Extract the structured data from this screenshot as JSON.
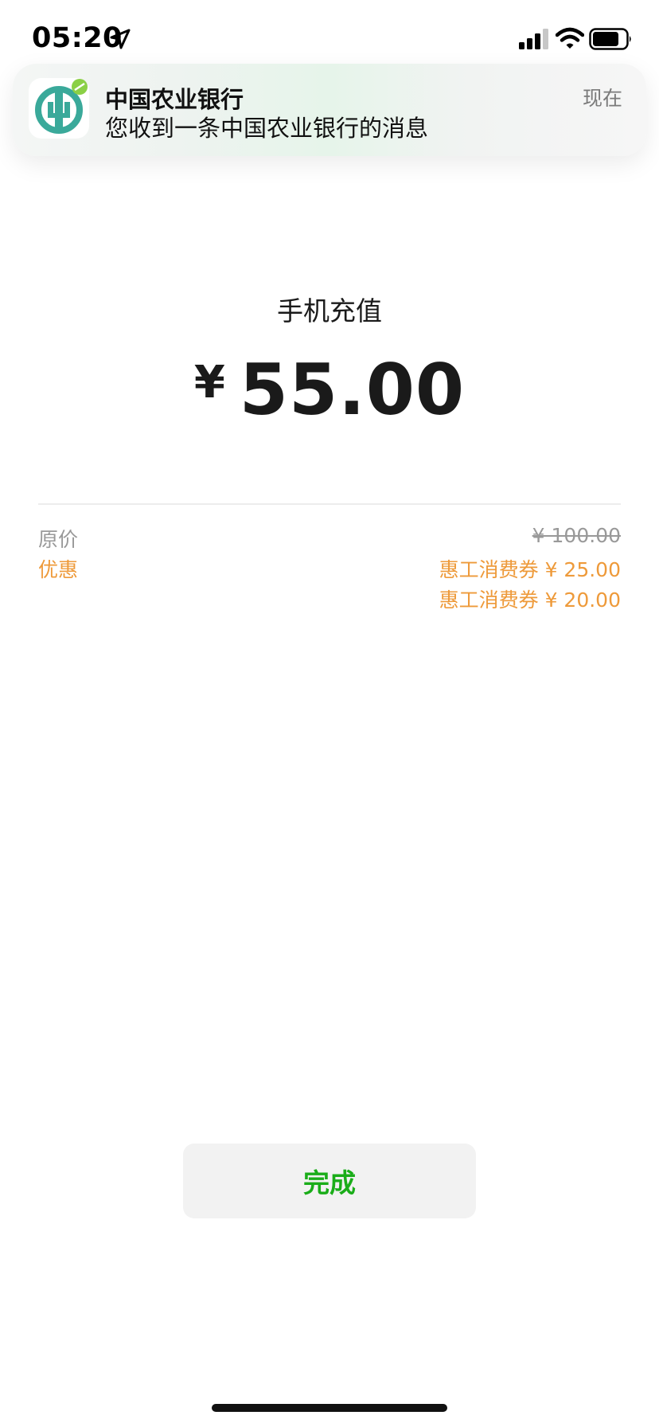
{
  "status_bar": {
    "time": "05:20",
    "icons": [
      "location-arrow-icon",
      "cellular-signal-icon",
      "wifi-icon",
      "battery-icon"
    ]
  },
  "notification": {
    "app_name": "中国农业银行",
    "message": "您收到一条中国农业银行的消息",
    "time": "现在",
    "icon": "abc-bank-logo-icon"
  },
  "payment": {
    "title": "手机充值",
    "currency_symbol": "¥",
    "amount": "55.00"
  },
  "details": {
    "original_price_label": "原价",
    "original_price_value": "¥ 100.00",
    "discount_label": "优惠",
    "coupons": [
      "惠工消费券 ¥ 25.00",
      "惠工消费券 ¥ 20.00"
    ]
  },
  "actions": {
    "done_label": "完成"
  },
  "colors": {
    "discount": "#ee9a3a",
    "done_button_text": "#1aad19",
    "done_button_bg": "#f2f2f2",
    "abc_logo_teal": "#3aa99a",
    "abc_logo_badge": "#8bd046"
  }
}
